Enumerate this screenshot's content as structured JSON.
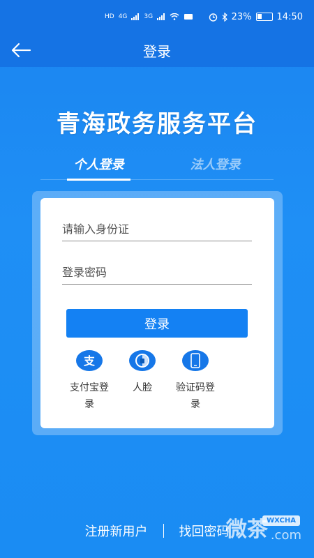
{
  "status_bar": {
    "network_left": "HD",
    "network_4g": "4G",
    "network_3g": "3G",
    "battery_percent": "23%",
    "time": "14:50"
  },
  "app_bar": {
    "back_icon": "arrow-left-icon",
    "title": "登录"
  },
  "platform_title": "青海政务服务平台",
  "tabs": [
    {
      "label": "个人登录",
      "active": true
    },
    {
      "label": "法人登录",
      "active": false
    }
  ],
  "form": {
    "id_placeholder": "请输入身份证",
    "password_placeholder": "登录密码",
    "login_button": "登录"
  },
  "alt_logins": [
    {
      "icon": "alipay-icon",
      "label_line1": "支付宝登",
      "label_line2": "录"
    },
    {
      "icon": "face-icon",
      "label_line1": "人脸",
      "label_line2": ""
    },
    {
      "icon": "phone-icon",
      "label_line1": "验证码登",
      "label_line2": "录"
    }
  ],
  "bottom": {
    "register": "注册新用户",
    "separator": "|",
    "forgot_password": "找回密码"
  },
  "watermark": {
    "text": "微茶",
    "domain": ".com",
    "badge": "WXCHA"
  },
  "colors": {
    "primary": "#1481f3",
    "header": "#1573e4"
  }
}
